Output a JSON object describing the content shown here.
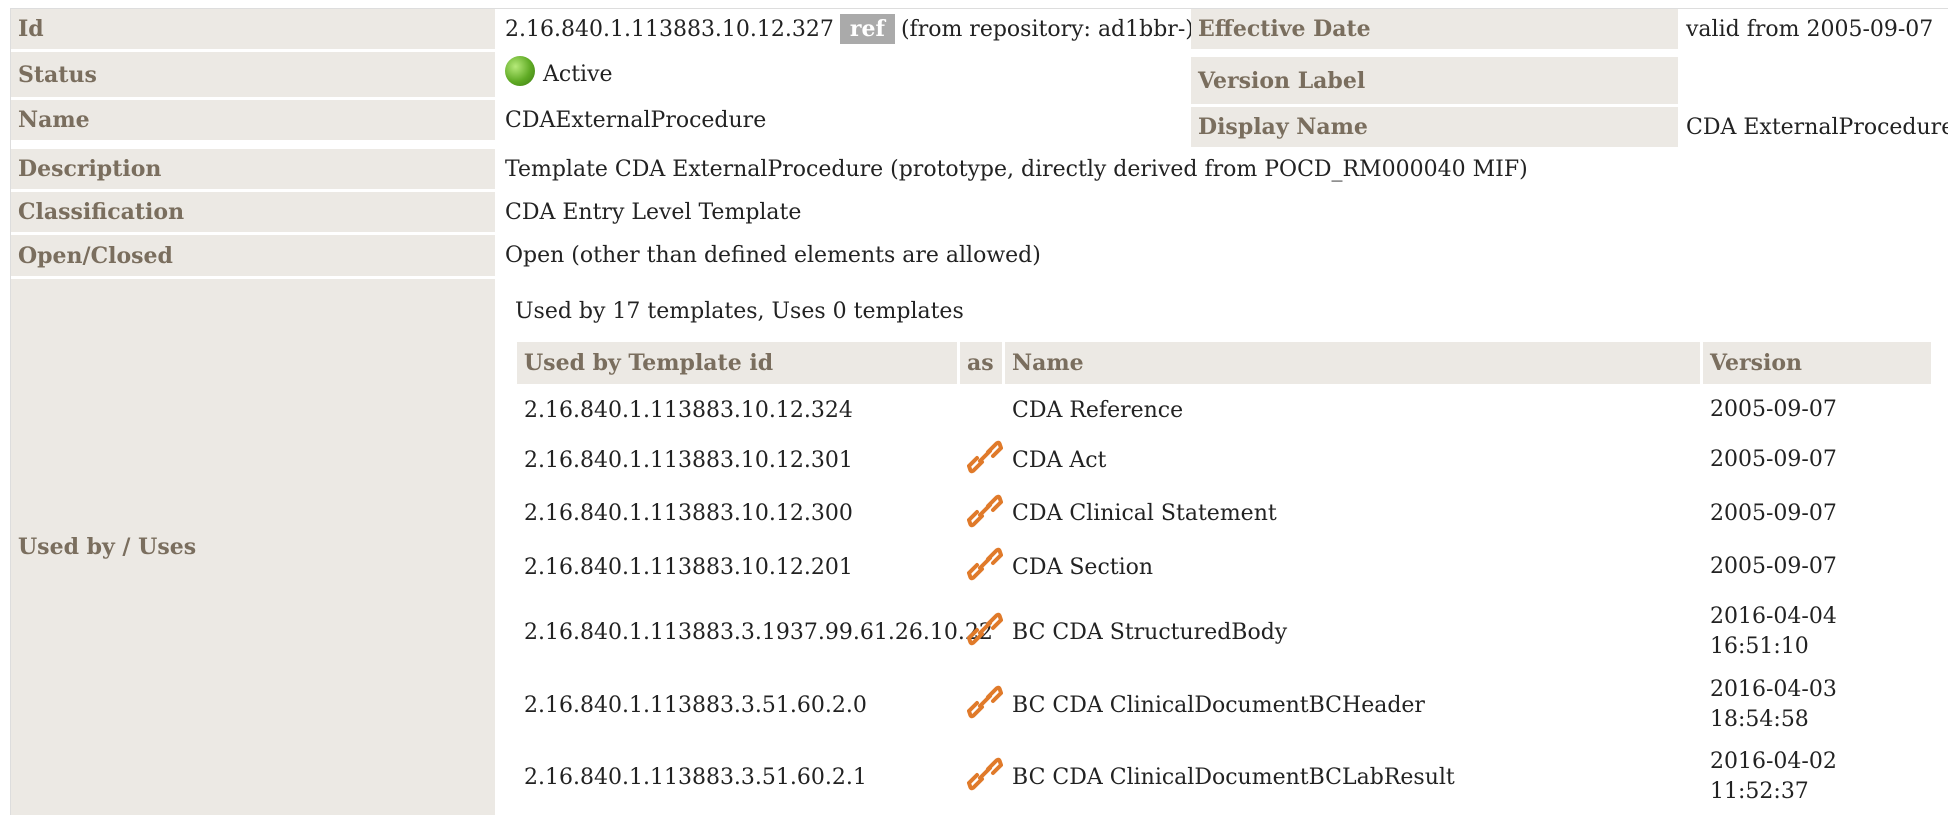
{
  "rows": {
    "id": {
      "label": "Id",
      "value": "2.16.840.1.113883.10.12.327",
      "ref_badge": "ref",
      "repo": "(from repository: ad1bbr-)"
    },
    "effective_date": {
      "label": "Effective Date",
      "value": "valid from 2005-09-07"
    },
    "status": {
      "label": "Status",
      "value": "Active"
    },
    "version_label": {
      "label": "Version Label",
      "value": ""
    },
    "name": {
      "label": "Name",
      "value": "CDAExternalProcedure"
    },
    "display_name": {
      "label": "Display Name",
      "value": "CDA ExternalProcedure"
    },
    "description": {
      "label": "Description",
      "value": "Template CDA ExternalProcedure (prototype, directly derived from POCD_RM000040 MIF)"
    },
    "classification": {
      "label": "Classification",
      "value": "CDA Entry Level Template"
    },
    "open_closed": {
      "label": "Open/Closed",
      "value": "Open (other than defined elements are allowed)"
    },
    "used_by": {
      "label": "Used by / Uses",
      "summary": "Used by 17 templates, Uses 0 templates"
    }
  },
  "used_by_table": {
    "headers": [
      "Used by Template id",
      "as",
      "Name",
      "Version"
    ],
    "rows": [
      {
        "id": "2.16.840.1.113883.10.12.324",
        "icon": "",
        "name": "CDA Reference",
        "version": "2005-09-07",
        "version2": ""
      },
      {
        "id": "2.16.840.1.113883.10.12.301",
        "icon": "link-icon",
        "name": "CDA Act",
        "version": "2005-09-07",
        "version2": ""
      },
      {
        "id": "2.16.840.1.113883.10.12.300",
        "icon": "link-icon",
        "name": "CDA Clinical Statement",
        "version": "2005-09-07",
        "version2": ""
      },
      {
        "id": "2.16.840.1.113883.10.12.201",
        "icon": "link-icon",
        "name": "CDA Section",
        "version": "2005-09-07",
        "version2": ""
      },
      {
        "id": "2.16.840.1.113883.3.1937.99.61.26.10.22",
        "icon": "link-icon",
        "name": "BC CDA StructuredBody",
        "version": "2016-04-04",
        "version2": "16:51:10"
      },
      {
        "id": "2.16.840.1.113883.3.51.60.2.0",
        "icon": "link-icon",
        "name": "BC CDA ClinicalDocumentBCHeader",
        "version": "2016-04-03",
        "version2": "18:54:58"
      },
      {
        "id": "2.16.840.1.113883.3.51.60.2.1",
        "icon": "link-icon",
        "name": "BC CDA ClinicalDocumentBCLabResult",
        "version": "2016-04-02",
        "version2": "11:52:37"
      }
    ]
  },
  "colors": {
    "label_bg": "#ece9e4",
    "label_text": "#7a6e5e",
    "link_icon": "#e07a2a",
    "status_green": "#5faa24"
  }
}
